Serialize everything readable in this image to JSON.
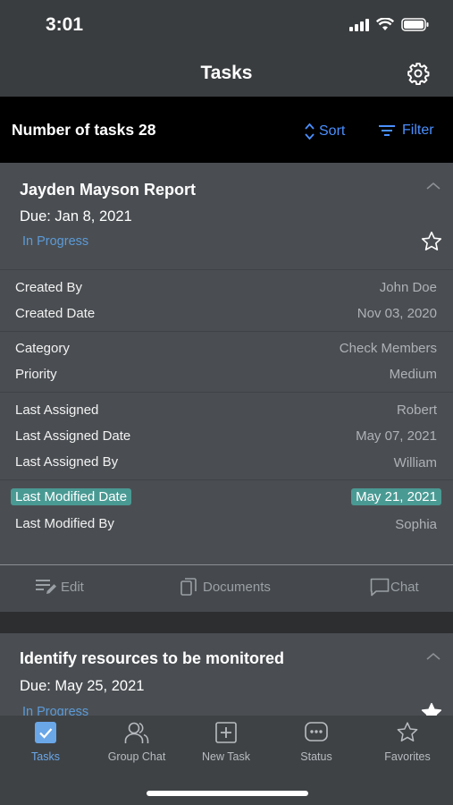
{
  "status_bar": {
    "time": "3:01"
  },
  "nav": {
    "title": "Tasks",
    "settings_icon": "gear-icon"
  },
  "toolbar": {
    "count_label": "Number of tasks 28",
    "sort_label": "Sort",
    "filter_label": "Filter"
  },
  "tasks": [
    {
      "title": "Jayden Mayson Report",
      "due": "Due: Jan 8, 2021",
      "status": "In Progress",
      "details": [
        {
          "label": "Created By",
          "value": "John Doe"
        },
        {
          "label": "Created Date",
          "value": "Nov 03, 2020"
        },
        {
          "label": "Category",
          "value": "Check Members"
        },
        {
          "label": "Priority",
          "value": "Medium"
        },
        {
          "label": "Last Assigned",
          "value": "Robert"
        },
        {
          "label": "Last Assigned Date",
          "value": "May 07, 2021"
        },
        {
          "label": "Last Assigned By",
          "value": "William"
        },
        {
          "label": "Last Modified Date",
          "value": "May 21, 2021",
          "highlighted": true
        },
        {
          "label": "Last Modified By",
          "value": "Sophia"
        }
      ],
      "actions": {
        "edit": "Edit",
        "documents": "Documents",
        "chat": "Chat"
      }
    },
    {
      "title": "Identify resources to be monitored",
      "due": "Due: May 25, 2021",
      "status": "In Progress"
    }
  ],
  "tabs": [
    {
      "label": "Tasks",
      "icon": "checkbox-icon",
      "active": true
    },
    {
      "label": "Group Chat",
      "icon": "people-icon"
    },
    {
      "label": "New Task",
      "icon": "plus-square-icon"
    },
    {
      "label": "Status",
      "icon": "status-chat-icon"
    },
    {
      "label": "Favorites",
      "icon": "star-icon"
    }
  ],
  "colors": {
    "accent": "#4a90ff",
    "status_blue": "#5c9ad8",
    "highlight_teal": "#4a9a94",
    "card_bg": "#4a4e52",
    "toolbar_bg": "#000000"
  }
}
